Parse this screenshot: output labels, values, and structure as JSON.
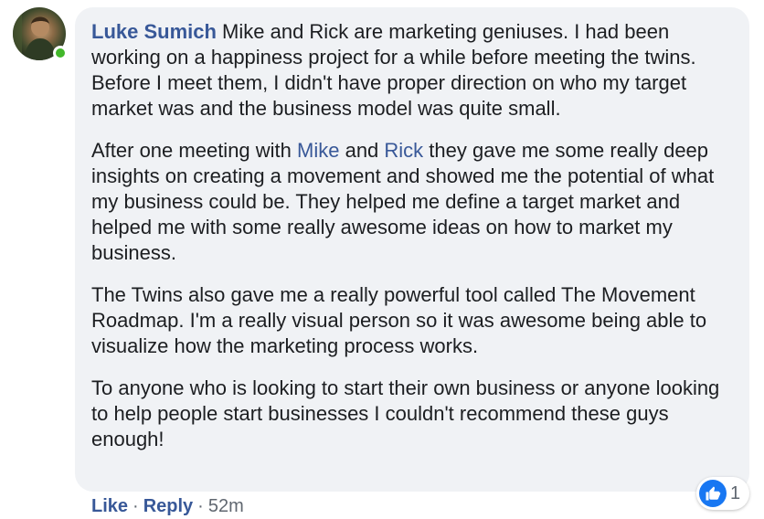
{
  "comment": {
    "author": "Luke Sumich",
    "p1_text": " Mike and Rick are marketing geniuses. I had been working on a happiness project for a while before meeting the twins. Before I meet them, I didn't have proper direction on who my target market was and the business model was quite small.",
    "p2_prefix": "After one meeting with ",
    "mention_1": "Mike",
    "p2_and": " and ",
    "mention_2": "Rick",
    "p2_suffix": " they gave me some really deep insights on creating a movement and showed me the potential of what my business could be. They helped me define a target market and helped me with some really awesome ideas on how to market my business.",
    "p3_text": "The Twins also gave me a really powerful tool called The Movement Roadmap. I'm a really visual person so it was awesome being able to visualize how the marketing process works.",
    "p4_text": "To anyone who is looking to start their own business or anyone looking to help people start businesses I couldn't recommend these guys enough!"
  },
  "actions": {
    "like_label": "Like",
    "reply_label": "Reply",
    "separator": "·",
    "time_ago": "52m"
  },
  "reactions": {
    "icon": "thumbs-up-icon",
    "count": "1",
    "color": "#1877f2"
  },
  "status": {
    "online": true,
    "online_color": "#42b72a"
  }
}
